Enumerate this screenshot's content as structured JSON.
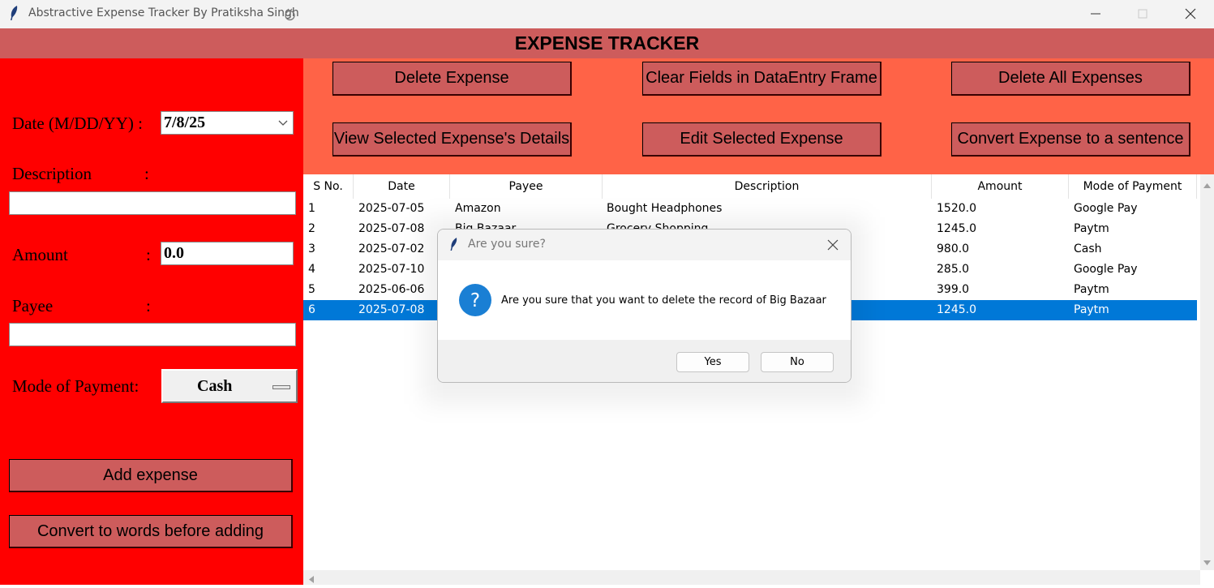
{
  "window": {
    "title": "Abstractive Expense Tracker By Pratiksha Singh"
  },
  "header": {
    "title": "EXPENSE TRACKER"
  },
  "form": {
    "date_label": "Date (M/DD/YY) :",
    "date_value": "7/8/25",
    "description_label": "Description",
    "description_value": "",
    "amount_label": "Amount",
    "amount_value": "0.0",
    "payee_label": "Payee",
    "payee_value": "",
    "mode_label": "Mode of Payment:",
    "mode_value": "Cash",
    "colon": ":",
    "add_button": "Add expense",
    "convert_button": "Convert to words before adding"
  },
  "toolbar": {
    "delete_expense": "Delete Expense",
    "clear_fields": "Clear Fields in DataEntry Frame",
    "delete_all": "Delete All Expenses",
    "view_details": "View Selected Expense's Details",
    "edit_expense": "Edit Selected Expense",
    "convert_sentence": "Convert Expense to a sentence"
  },
  "table": {
    "columns": [
      "S No.",
      "Date",
      "Payee",
      "Description",
      "Amount",
      "Mode of Payment"
    ],
    "rows": [
      [
        "1",
        "2025-07-05",
        "Amazon",
        "Bought Headphones",
        "1520.0",
        "Google Pay"
      ],
      [
        "2",
        "2025-07-08",
        "Big Bazaar",
        "Grocery Shopping",
        "1245.0",
        "Paytm"
      ],
      [
        "3",
        "2025-07-02",
        "",
        "",
        "980.0",
        "Cash"
      ],
      [
        "4",
        "2025-07-10",
        "",
        "",
        "285.0",
        "Google Pay"
      ],
      [
        "5",
        "2025-06-06",
        "",
        "",
        "399.0",
        "Paytm"
      ],
      [
        "6",
        "2025-07-08",
        "",
        "",
        "1245.0",
        "Paytm"
      ]
    ],
    "selected_row": 6
  },
  "dialog": {
    "title": "Are you sure?",
    "message": "Are you sure that you want to delete the record of Big Bazaar",
    "yes": "Yes",
    "no": "No"
  },
  "colors": {
    "header_bg": "#cd5c5c",
    "left_panel_bg": "#ff0000",
    "toolbar_bg": "#ff6347",
    "button_bg": "#cd5c5c",
    "selection": "#0078d7",
    "question_icon": "#1a7fd4"
  },
  "icons": [
    "feather-icon",
    "tkinter-icon",
    "minimize-icon",
    "maximize-icon",
    "close-icon",
    "question-icon",
    "chevron-down-icon",
    "scroll-up-arrow-icon",
    "scroll-down-arrow-icon",
    "scroll-left-arrow-icon"
  ]
}
